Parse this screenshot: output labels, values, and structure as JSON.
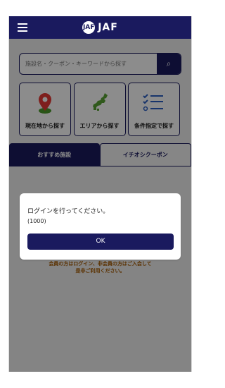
{
  "app": {
    "logo_text": "JAF",
    "logo_mark": "JAF"
  },
  "search": {
    "placeholder": "施設名・クーポン・キーワードから探す"
  },
  "categories": [
    {
      "label": "現在地から探す",
      "icon": "location-pin-icon"
    },
    {
      "label": "エリアから探す",
      "icon": "japan-map-icon"
    },
    {
      "label": "条件指定で探す",
      "icon": "checklist-icon"
    }
  ],
  "tabs": {
    "left": "おすすめ施設",
    "right": "イチオシクーポン"
  },
  "info": {
    "line1": "会員の方はログイン、非会員の方はご入会して",
    "line2": "是非ご利用ください。"
  },
  "dialog": {
    "title": "ログインを行ってください。",
    "code": "(1000)",
    "ok": "OK"
  },
  "colors": {
    "brand": "#1a1a5e",
    "accent_red": "#e53935",
    "accent_green": "#58a233",
    "info_text": "#a65a00"
  }
}
